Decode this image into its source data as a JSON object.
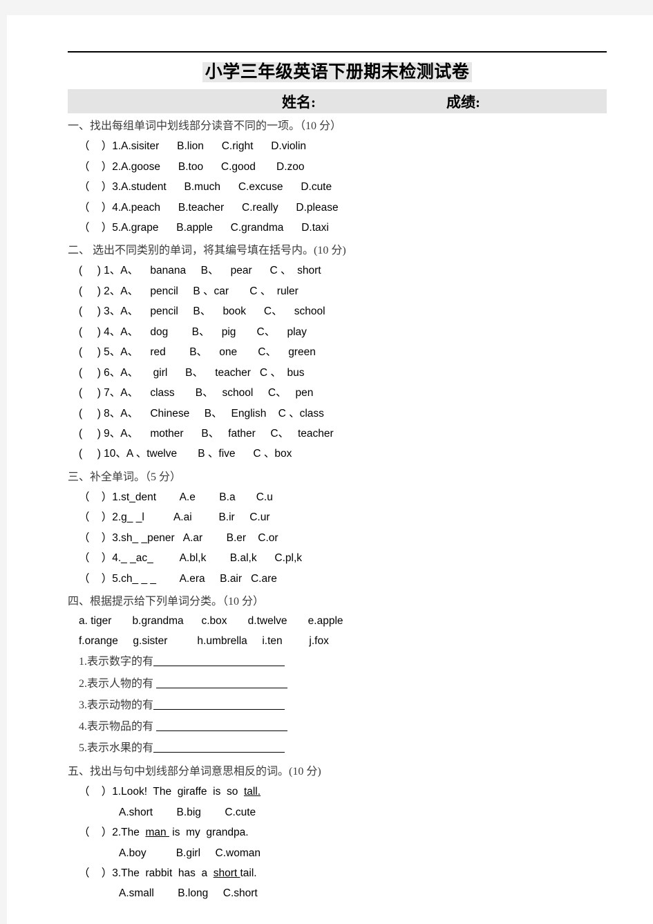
{
  "document": {
    "title": "小学三年级英语下册期末检测试卷",
    "name_label": "姓名:",
    "score_label": "成绩:"
  },
  "sections": [
    {
      "heading": "一、找出每组单词中划线部分读音不同的一项。（10 分）",
      "items": [
        "（    ）1.A.sisiter      B.lion      C.right      D.violin",
        "（    ）2.A.goose      B.too      C.good       D.zoo",
        "（    ）3.A.student      B.much      C.excuse      D.cute",
        "（    ）4.A.peach      B.teacher      C.really      D.please",
        "（    ）5.A.grape      B.apple      C.grandma      D.taxi"
      ]
    },
    {
      "heading": "二、 选出不同类别的单词，将其编号填在括号内。(10 分)",
      "items": [
        "(     ) 1、A、    banana     B、    pear      C 、  short",
        "(     ) 2、A、    pencil     B 、car       C 、  ruler",
        "(     ) 3、A、    pencil     B、    book      C、    school",
        "(     ) 4、A、    dog        B、    pig       C、    play",
        "(     ) 5、A、    red        B、    one       C、    green",
        "(     ) 6、A、     girl      B、    teacher   C 、  bus",
        "(     ) 7、A、    class       B、   school     C、   pen",
        "(     ) 8、A、    Chinese     B、   English    C 、class",
        "(     ) 9、A、    mother      B、   father     C、   teacher",
        "(     ) 10、A 、twelve       B 、five      C 、box"
      ]
    },
    {
      "heading": "三、补全单词。（5 分）",
      "items": [
        "（    ）1.st_dent        A.e        B.a       C.u",
        "（    ）2.g_ _l          A.ai         B.ir     C.ur",
        "（    ）3.sh_ _pener   A.ar        B.er    C.or",
        "（    ）4._ _ac_         A.bl,k        B.al,k      C.pl,k",
        "（    ）5.ch_ _ _        A.era     B.air   C.are"
      ]
    },
    {
      "heading": "四、根据提示给下列单词分类。（10 分）",
      "wordbank": [
        "a. tiger       b.grandma      c.box       d.twelve       e.apple",
        "f.orange     g.sister          h.umbrella     i.ten         j.fox"
      ],
      "categories": [
        {
          "label": "1.表示数字的有",
          "blank_width": 190,
          "indent": 0
        },
        {
          "label": "2.表示人物的有 ",
          "blank_width": 190,
          "indent": 0
        },
        {
          "label": "3.表示动物的有",
          "blank_width": 190,
          "indent": 0
        },
        {
          "label": "4.表示物品的有 ",
          "blank_width": 190,
          "indent": 0
        },
        {
          "label": "5.表示水果的有",
          "blank_width": 190,
          "indent": 0
        }
      ]
    },
    {
      "heading": "五、找出与句中划线部分单词意思相反的词。(10 分)",
      "items": [
        {
          "q": "（    ）1.Look!  The  giraffe  is  so  ",
          "u": "tall.",
          "tail": ""
        },
        {
          "opts": "A.short        B.big        C.cute"
        },
        {
          "q": "（    ）2.The  ",
          "u": "man ",
          "tail": " is  my  grandpa."
        },
        {
          "opts": "A.boy          B.girl     C.woman"
        },
        {
          "q": "（    ）3.The  rabbit  has  a  ",
          "u": "short ",
          "tail": "tail."
        },
        {
          "opts": "A.small        B.long     C.short"
        }
      ]
    }
  ]
}
